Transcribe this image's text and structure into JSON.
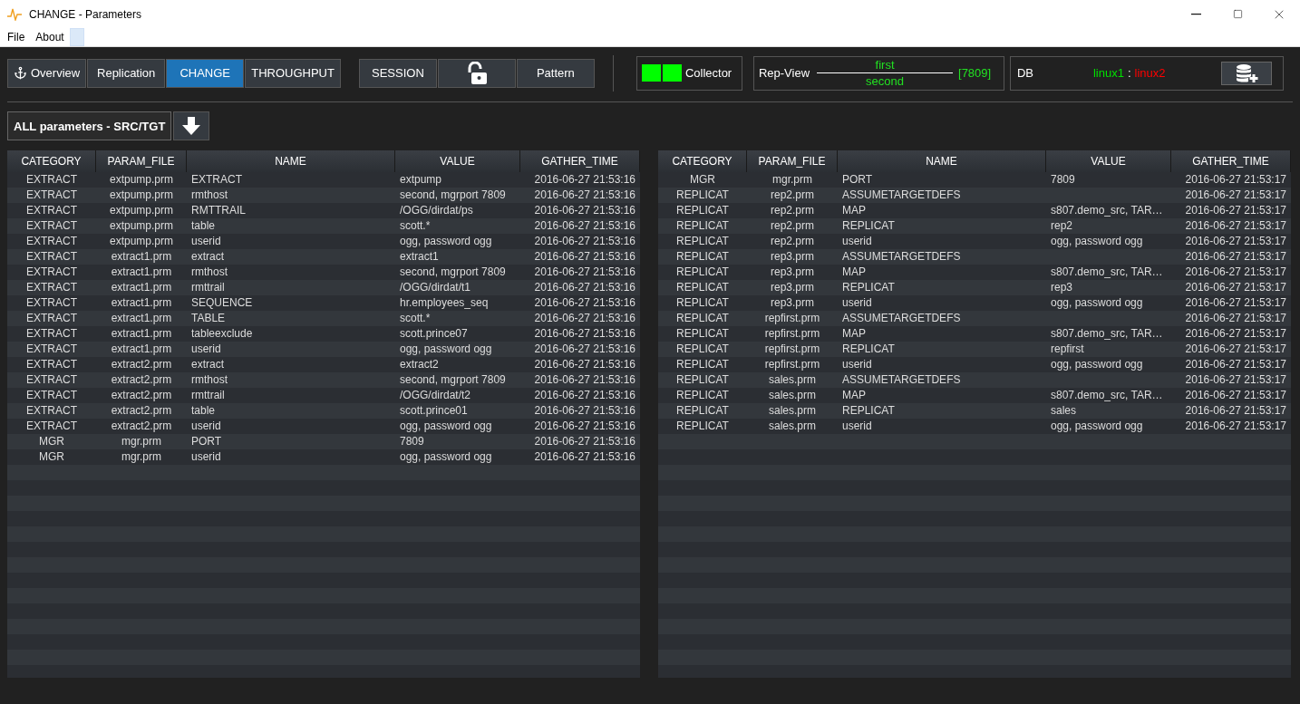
{
  "window": {
    "title": "CHANGE - Parameters"
  },
  "menu": [
    "File",
    "About"
  ],
  "nav_groups": [
    [
      {
        "kind": "anchor",
        "label": "Overview",
        "selected": false
      },
      {
        "kind": "text",
        "label": "Replication",
        "selected": false
      },
      {
        "kind": "text",
        "label": "CHANGE",
        "selected": true
      },
      {
        "kind": "text",
        "label": "THROUGHPUT",
        "selected": false
      }
    ],
    [
      {
        "kind": "text",
        "label": "SESSION",
        "selected": false
      },
      {
        "kind": "lock",
        "selected": false
      },
      {
        "kind": "text",
        "label": "Pattern",
        "selected": false
      }
    ]
  ],
  "collector": {
    "label": "Collector",
    "lights": [
      {
        "color": "#00ff00"
      },
      {
        "color": "#00ff00"
      }
    ]
  },
  "rep_view": {
    "label": "Rep-View",
    "source": "first",
    "target": "second",
    "port": "[7809]"
  },
  "db": {
    "label": "DB",
    "hosts": [
      {
        "name": "linux1",
        "color": "#00e000"
      },
      {
        "name": "linux2",
        "color": "#ff0000"
      }
    ],
    "separator": ":"
  },
  "section": {
    "label": "ALL parameters - SRC/TGT"
  },
  "tables": [
    {
      "columns": [
        "CATEGORY",
        "PARAM_FILE",
        "NAME",
        "VALUE",
        "GATHER_TIME"
      ],
      "rows": [
        [
          "EXTRACT",
          "extpump.prm",
          "EXTRACT",
          "extpump",
          "2016-06-27 21:53:16"
        ],
        [
          "EXTRACT",
          "extpump.prm",
          "rmthost",
          "second, mgrport 7809",
          "2016-06-27 21:53:16"
        ],
        [
          "EXTRACT",
          "extpump.prm",
          "RMTTRAIL",
          "/OGG/dirdat/ps",
          "2016-06-27 21:53:16"
        ],
        [
          "EXTRACT",
          "extpump.prm",
          "table",
          "scott.*",
          "2016-06-27 21:53:16"
        ],
        [
          "EXTRACT",
          "extpump.prm",
          "userid",
          "ogg, password ogg",
          "2016-06-27 21:53:16"
        ],
        [
          "EXTRACT",
          "extract1.prm",
          "extract",
          "extract1",
          "2016-06-27 21:53:16"
        ],
        [
          "EXTRACT",
          "extract1.prm",
          "rmthost",
          "second, mgrport 7809",
          "2016-06-27 21:53:16"
        ],
        [
          "EXTRACT",
          "extract1.prm",
          "rmttrail",
          "/OGG/dirdat/t1",
          "2016-06-27 21:53:16"
        ],
        [
          "EXTRACT",
          "extract1.prm",
          "SEQUENCE",
          "hr.employees_seq",
          "2016-06-27 21:53:16"
        ],
        [
          "EXTRACT",
          "extract1.prm",
          "TABLE",
          "scott.*",
          "2016-06-27 21:53:16"
        ],
        [
          "EXTRACT",
          "extract1.prm",
          "tableexclude",
          "scott.prince07",
          "2016-06-27 21:53:16"
        ],
        [
          "EXTRACT",
          "extract1.prm",
          "userid",
          "ogg, password ogg",
          "2016-06-27 21:53:16"
        ],
        [
          "EXTRACT",
          "extract2.prm",
          "extract",
          "extract2",
          "2016-06-27 21:53:16"
        ],
        [
          "EXTRACT",
          "extract2.prm",
          "rmthost",
          "second, mgrport 7809",
          "2016-06-27 21:53:16"
        ],
        [
          "EXTRACT",
          "extract2.prm",
          "rmttrail",
          "/OGG/dirdat/t2",
          "2016-06-27 21:53:16"
        ],
        [
          "EXTRACT",
          "extract2.prm",
          "table",
          "scott.prince01",
          "2016-06-27 21:53:16"
        ],
        [
          "EXTRACT",
          "extract2.prm",
          "userid",
          "ogg, password ogg",
          "2016-06-27 21:53:16"
        ],
        [
          "MGR",
          "mgr.prm",
          "PORT",
          "7809",
          "2016-06-27 21:53:16"
        ],
        [
          "MGR",
          "mgr.prm",
          "userid",
          "ogg, password ogg",
          "2016-06-27 21:53:16"
        ]
      ]
    },
    {
      "columns": [
        "CATEGORY",
        "PARAM_FILE",
        "NAME",
        "VALUE",
        "GATHER_TIME"
      ],
      "rows": [
        [
          "MGR",
          "mgr.prm",
          "PORT",
          "7809",
          "2016-06-27 21:53:17"
        ],
        [
          "REPLICAT",
          "rep2.prm",
          "ASSUMETARGETDEFS",
          "",
          "2016-06-27 21:53:17"
        ],
        [
          "REPLICAT",
          "rep2.prm",
          "MAP",
          "s807.demo_src, TAR…",
          "2016-06-27 21:53:17"
        ],
        [
          "REPLICAT",
          "rep2.prm",
          "REPLICAT",
          "rep2",
          "2016-06-27 21:53:17"
        ],
        [
          "REPLICAT",
          "rep2.prm",
          "userid",
          "ogg, password ogg",
          "2016-06-27 21:53:17"
        ],
        [
          "REPLICAT",
          "rep3.prm",
          "ASSUMETARGETDEFS",
          "",
          "2016-06-27 21:53:17"
        ],
        [
          "REPLICAT",
          "rep3.prm",
          "MAP",
          "s807.demo_src, TAR…",
          "2016-06-27 21:53:17"
        ],
        [
          "REPLICAT",
          "rep3.prm",
          "REPLICAT",
          "rep3",
          "2016-06-27 21:53:17"
        ],
        [
          "REPLICAT",
          "rep3.prm",
          "userid",
          "ogg, password ogg",
          "2016-06-27 21:53:17"
        ],
        [
          "REPLICAT",
          "repfirst.prm",
          "ASSUMETARGETDEFS",
          "",
          "2016-06-27 21:53:17"
        ],
        [
          "REPLICAT",
          "repfirst.prm",
          "MAP",
          "s807.demo_src, TAR…",
          "2016-06-27 21:53:17"
        ],
        [
          "REPLICAT",
          "repfirst.prm",
          "REPLICAT",
          "repfirst",
          "2016-06-27 21:53:17"
        ],
        [
          "REPLICAT",
          "repfirst.prm",
          "userid",
          "ogg, password ogg",
          "2016-06-27 21:53:17"
        ],
        [
          "REPLICAT",
          "sales.prm",
          "ASSUMETARGETDEFS",
          "",
          "2016-06-27 21:53:17"
        ],
        [
          "REPLICAT",
          "sales.prm",
          "MAP",
          "s807.demo_src, TAR…",
          "2016-06-27 21:53:17"
        ],
        [
          "REPLICAT",
          "sales.prm",
          "REPLICAT",
          "sales",
          "2016-06-27 21:53:17"
        ],
        [
          "REPLICAT",
          "sales.prm",
          "userid",
          "ogg, password ogg",
          "2016-06-27 21:53:17"
        ]
      ]
    }
  ]
}
